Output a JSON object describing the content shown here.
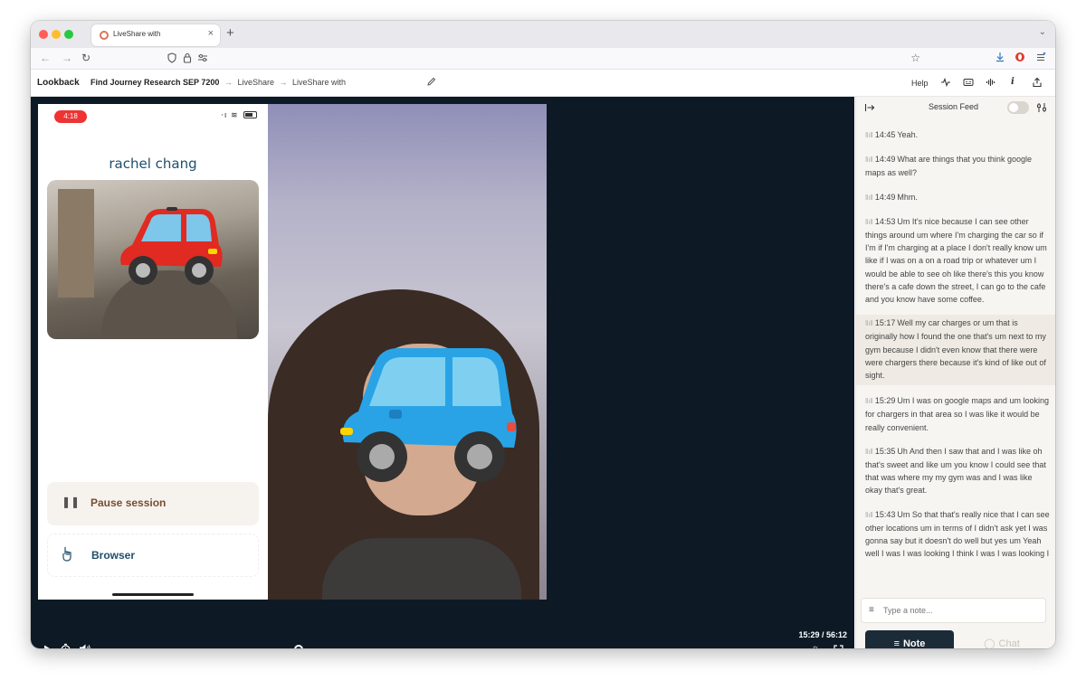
{
  "browser": {
    "tab_title": "LiveShare with",
    "tab_close": "×",
    "new_tab": "+",
    "tab_menu": "⌄",
    "nav": {
      "back": "←",
      "forward": "→",
      "reload": "↻"
    },
    "address_icons": [
      "shield-icon",
      "lock-icon",
      "permissions-icon"
    ],
    "bookmark": "☆"
  },
  "app": {
    "brand": "Lookback",
    "breadcrumb": {
      "project": "Find Journey Research SEP 7200",
      "section": "LiveShare",
      "session": "LiveShare with"
    },
    "header_right": {
      "help": "Help"
    }
  },
  "phone": {
    "time": "4:18",
    "participant_name": "rachel chang",
    "pause_label": "Pause session",
    "browser_label": "Browser",
    "accent": "#7a4e2d",
    "browser_color": "#1f4e6b"
  },
  "player": {
    "timecode": "15:29 / 56:12",
    "progress": 0.28
  },
  "feed": {
    "title": "Session Feed",
    "entries": [
      {
        "time": "14:45",
        "text": "Yeah."
      },
      {
        "time": "14:49",
        "text": "What are things that you think google maps as well?"
      },
      {
        "time": "14:49",
        "text": "Mhm."
      },
      {
        "time": "14:53",
        "text": "Um It's nice because I can see other things around um where I'm charging the car so if I'm if I'm charging at a place I don't really know um like if I was on a on a road trip or whatever um I would be able to see oh like there's this you know there's a cafe down the street, I can go to the cafe and you know have some coffee."
      },
      {
        "time": "15:17",
        "text": "Well my car charges or um that is originally how I found the one that's um next to my gym because I didn't even know that there were were chargers there because it's kind of like out of sight.",
        "highlight": true
      },
      {
        "time": "15:29",
        "text": "Um I was on google maps and um looking for chargers in that area so I was like it would be really convenient."
      },
      {
        "time": "15:35",
        "text": "Uh And then I saw that and I was like oh that's sweet and like um you know I could see that that was where my my gym was and I was like okay that's great."
      },
      {
        "time": "15:43",
        "text": "Um So that that's really nice that I can see other locations um in terms of I didn't ask yet I was gonna say but it doesn't do well but yes um Yeah well I was I was looking I think I was I was looking I think directly I was trying to choose gyms and I was looking where the gym was in relation to"
      }
    ],
    "note_placeholder": "Type a note...",
    "note_button": "Note",
    "chat_button": "Chat"
  }
}
